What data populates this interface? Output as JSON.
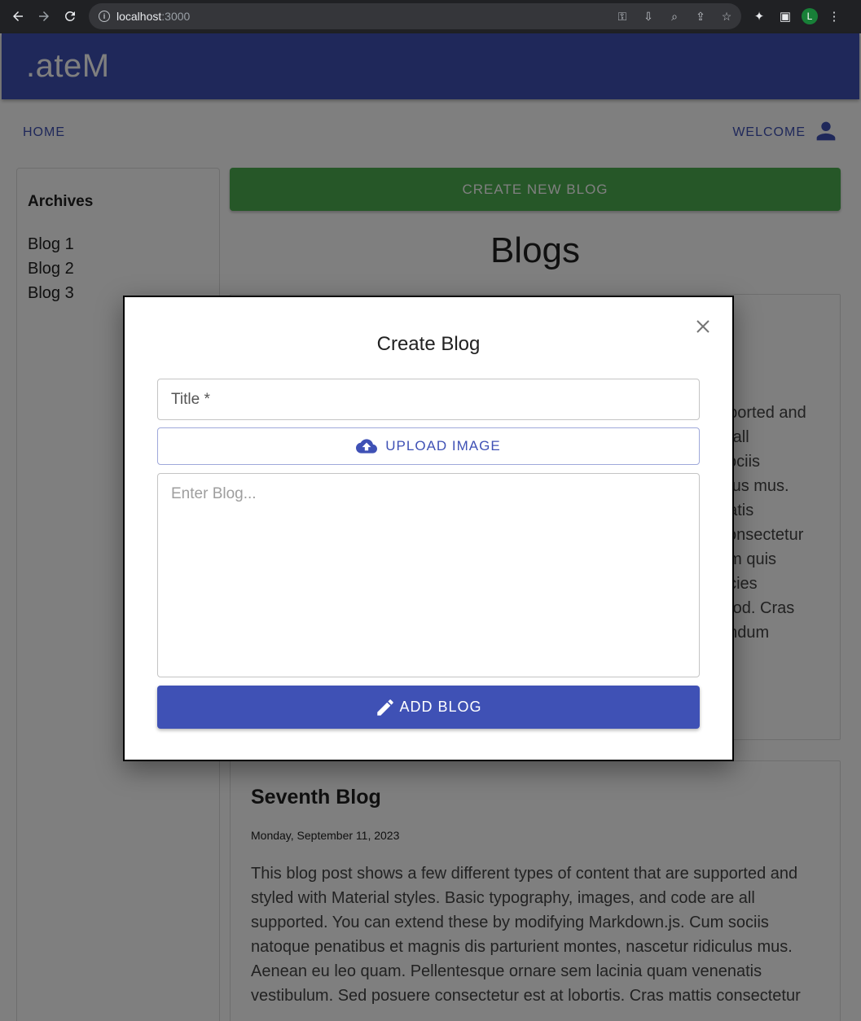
{
  "browser": {
    "host": "localhost",
    "port": ":3000",
    "profile_initial": "L"
  },
  "app": {
    "brand": ".ateM",
    "nav_home": "HOME",
    "nav_welcome": "WELCOME",
    "sidebar": {
      "title": "Archives",
      "items": [
        "Blog 1",
        "Blog 2",
        "Blog 3"
      ]
    },
    "create_button": "CREATE NEW BLOG",
    "blogs_heading": "Blogs",
    "posts": [
      {
        "lines": [
          "pported and",
          "e all",
          "sociis",
          "ulus mus.",
          "natis",
          "consectetur",
          "am quis",
          "ricies",
          "mod. Cras",
          "endum"
        ]
      },
      {
        "title": "Seventh Blog",
        "date": "Monday, September 11, 2023",
        "body": "This blog post shows a few different types of content that are supported and styled with Material styles. Basic typography, images, and code are all supported. You can extend these by modifying Markdown.js. Cum sociis natoque penatibus et magnis dis parturient montes, nascetur ridiculus mus. Aenean eu leo quam. Pellentesque ornare sem lacinia quam venenatis vestibulum. Sed posuere consectetur est at lobortis. Cras mattis consectetur purus sit amet fermentum. Curabitur blandit tempus porttitor. Nullam quis"
      }
    ]
  },
  "modal": {
    "title": "Create Blog",
    "title_placeholder": "Title *",
    "upload_label": "UPLOAD IMAGE",
    "blog_placeholder": "Enter Blog...",
    "add_label": "ADD BLOG"
  },
  "colors": {
    "primary": "#3f51b5",
    "success": "#4caf50"
  }
}
